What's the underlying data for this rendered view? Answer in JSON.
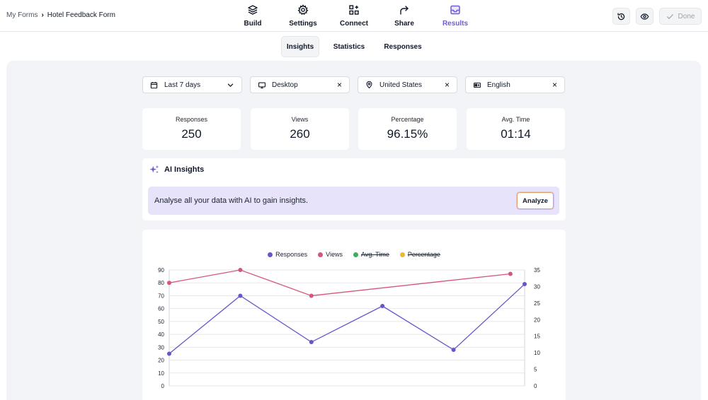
{
  "breadcrumb": {
    "root": "My Forms",
    "separator": "›",
    "current": "Hotel Feedback Form"
  },
  "nav_tabs": [
    {
      "label": "Build",
      "icon": "layers-icon"
    },
    {
      "label": "Settings",
      "icon": "gear-icon"
    },
    {
      "label": "Connect",
      "icon": "connect-icon"
    },
    {
      "label": "Share",
      "icon": "share-arrow-icon"
    },
    {
      "label": "Results",
      "icon": "inbox-icon",
      "active": true
    }
  ],
  "actions": {
    "history_icon": "history-icon",
    "preview_icon": "eye-icon",
    "done_label": "Done"
  },
  "sub_tabs": [
    {
      "label": "Insights",
      "active": true
    },
    {
      "label": "Statistics"
    },
    {
      "label": "Responses"
    }
  ],
  "filters": {
    "date": {
      "label": "Last 7 days",
      "icon": "calendar-icon"
    },
    "device": {
      "label": "Desktop",
      "icon": "monitor-icon"
    },
    "country": {
      "label": "United States",
      "icon": "location-pin-icon"
    },
    "language": {
      "label": "English",
      "icon": "language-icon"
    },
    "clear_symbol": "×"
  },
  "stats": [
    {
      "label": "Responses",
      "value": "250"
    },
    {
      "label": "Views",
      "value": "260"
    },
    {
      "label": "Percentage",
      "value": "96.15%"
    },
    {
      "label": "Avg. Time",
      "value": "01:14"
    }
  ],
  "ai_insights": {
    "title": "AI Insights",
    "message": "Analyse all your data with AI to gain insights.",
    "button": "Analyze"
  },
  "colors": {
    "accent": "#6d5dd3",
    "responses": "#6457c9",
    "views": "#d4567a",
    "avg_time": "#3fae5a",
    "percentage": "#e7b83a"
  },
  "chart_data": {
    "type": "line",
    "legend": [
      {
        "name": "Responses",
        "color": "#6457c9",
        "hidden": false
      },
      {
        "name": "Views",
        "color": "#d4567a",
        "hidden": false
      },
      {
        "name": "Avg. Time",
        "color": "#3fae5a",
        "hidden": true
      },
      {
        "name": "Percentage",
        "color": "#e7b83a",
        "hidden": true
      }
    ],
    "legend_position": "top-center",
    "y_left": {
      "min": 0,
      "max": 90,
      "ticks": [
        "0",
        "10",
        "20",
        "30",
        "40",
        "50",
        "60",
        "70",
        "80",
        "90"
      ]
    },
    "y_right": {
      "min": 0,
      "max": 35,
      "ticks": [
        "0",
        "5",
        "10",
        "15",
        "20",
        "25",
        "30",
        "35"
      ]
    },
    "grid": true,
    "series": [
      {
        "name": "Responses",
        "axis": "left",
        "points": [
          [
            0,
            25
          ],
          [
            1,
            70
          ],
          [
            2,
            34
          ],
          [
            3,
            62
          ],
          [
            4,
            28
          ],
          [
            5,
            79
          ]
        ]
      },
      {
        "name": "Views",
        "axis": "left",
        "points": [
          [
            0,
            80
          ],
          [
            1,
            90
          ],
          [
            2,
            70
          ],
          [
            4.8,
            87
          ]
        ]
      }
    ],
    "x_count": 6
  }
}
